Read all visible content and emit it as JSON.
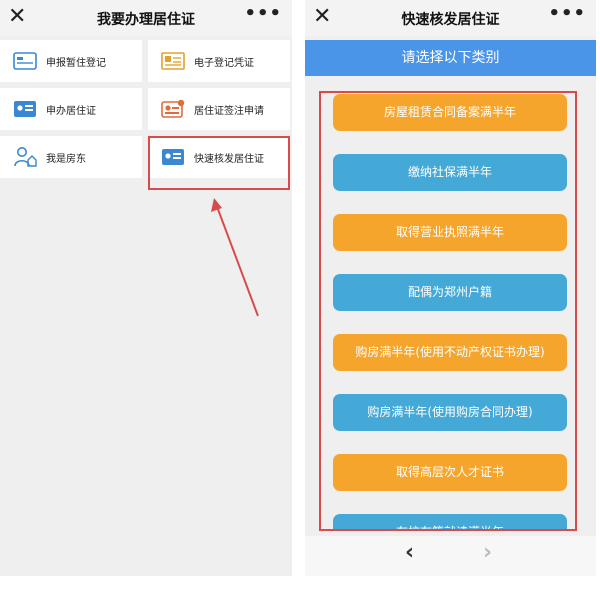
{
  "left_panel": {
    "header": {
      "close": "✕",
      "title": "我要办理居住证",
      "more": "•••"
    },
    "grid": [
      {
        "label": "申报暂住登记",
        "icon": "card-icon"
      },
      {
        "label": "电子登记凭证",
        "icon": "certificate-icon"
      },
      {
        "label": "申办居住证",
        "icon": "id-card-icon"
      },
      {
        "label": "居住证签注申请",
        "icon": "endorsement-icon"
      },
      {
        "label": "我是房东",
        "icon": "landlord-icon"
      },
      {
        "label": "快速核发居住证",
        "icon": "id-card-icon"
      }
    ]
  },
  "right_panel": {
    "header": {
      "close": "✕",
      "title": "快速核发居住证",
      "more": "•••"
    },
    "subheader": "请选择以下类别",
    "options": [
      {
        "label": "房屋租赁合同备案满半年",
        "color": "#f6a52c"
      },
      {
        "label": "缴纳社保满半年",
        "color": "#44a9d6"
      },
      {
        "label": "取得营业执照满半年",
        "color": "#f6a52c"
      },
      {
        "label": "配偶为郑州户籍",
        "color": "#44a9d6"
      },
      {
        "label": "购房满半年(使用不动产权证书办理)",
        "color": "#f6a52c"
      },
      {
        "label": "购房满半年(使用购房合同办理)",
        "color": "#44a9d6"
      },
      {
        "label": "取得高层次人才证书",
        "color": "#f6a52c"
      },
      {
        "label": "在校在籍就读满半年",
        "color": "#44a9d6"
      }
    ],
    "footer": {
      "back": "‹",
      "forward": "›"
    }
  },
  "colors": {
    "accent": "#4a95e8",
    "highlight": "#d94b4b",
    "orange": "#f6a52c",
    "blue": "#44a9d6"
  }
}
